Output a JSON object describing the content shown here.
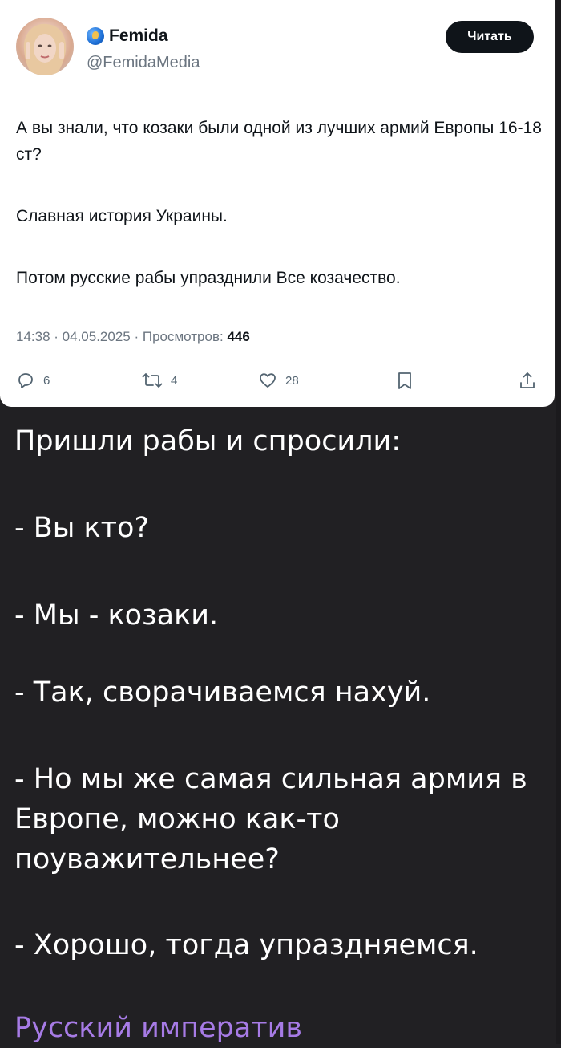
{
  "tweet": {
    "author_name": "Femida",
    "author_handle": "@FemidaMedia",
    "follow_label": "Читать",
    "paragraphs": [
      "А вы знали, что козаки были одной из лучших армий Европы 16-18 ст?",
      "Славная история Украины.",
      "Потом русские рабы упразднили Все козачество."
    ],
    "time": "14:38",
    "date": "04.05.2025",
    "views_label": "Просмотров:",
    "views_count": "446",
    "replies": "6",
    "retweets": "4",
    "likes": "28",
    "icons": [
      "reply-icon",
      "retweet-icon",
      "like-icon",
      "bookmark-icon",
      "share-icon"
    ]
  },
  "caption": {
    "lines": [
      "Пришли рабы и спросили:",
      "- Вы кто?",
      "- Мы - козаки.",
      "- Так, сворачиваемся нахуй.",
      "- Но мы же самая сильная армия в Европе, можно как-то поуважительнее?",
      "- Хорошо, тогда упраздняемся."
    ],
    "channel": "Русский императив"
  },
  "colors": {
    "background": "#212023",
    "card": "#ffffff",
    "channel_accent": "#a77be6"
  }
}
